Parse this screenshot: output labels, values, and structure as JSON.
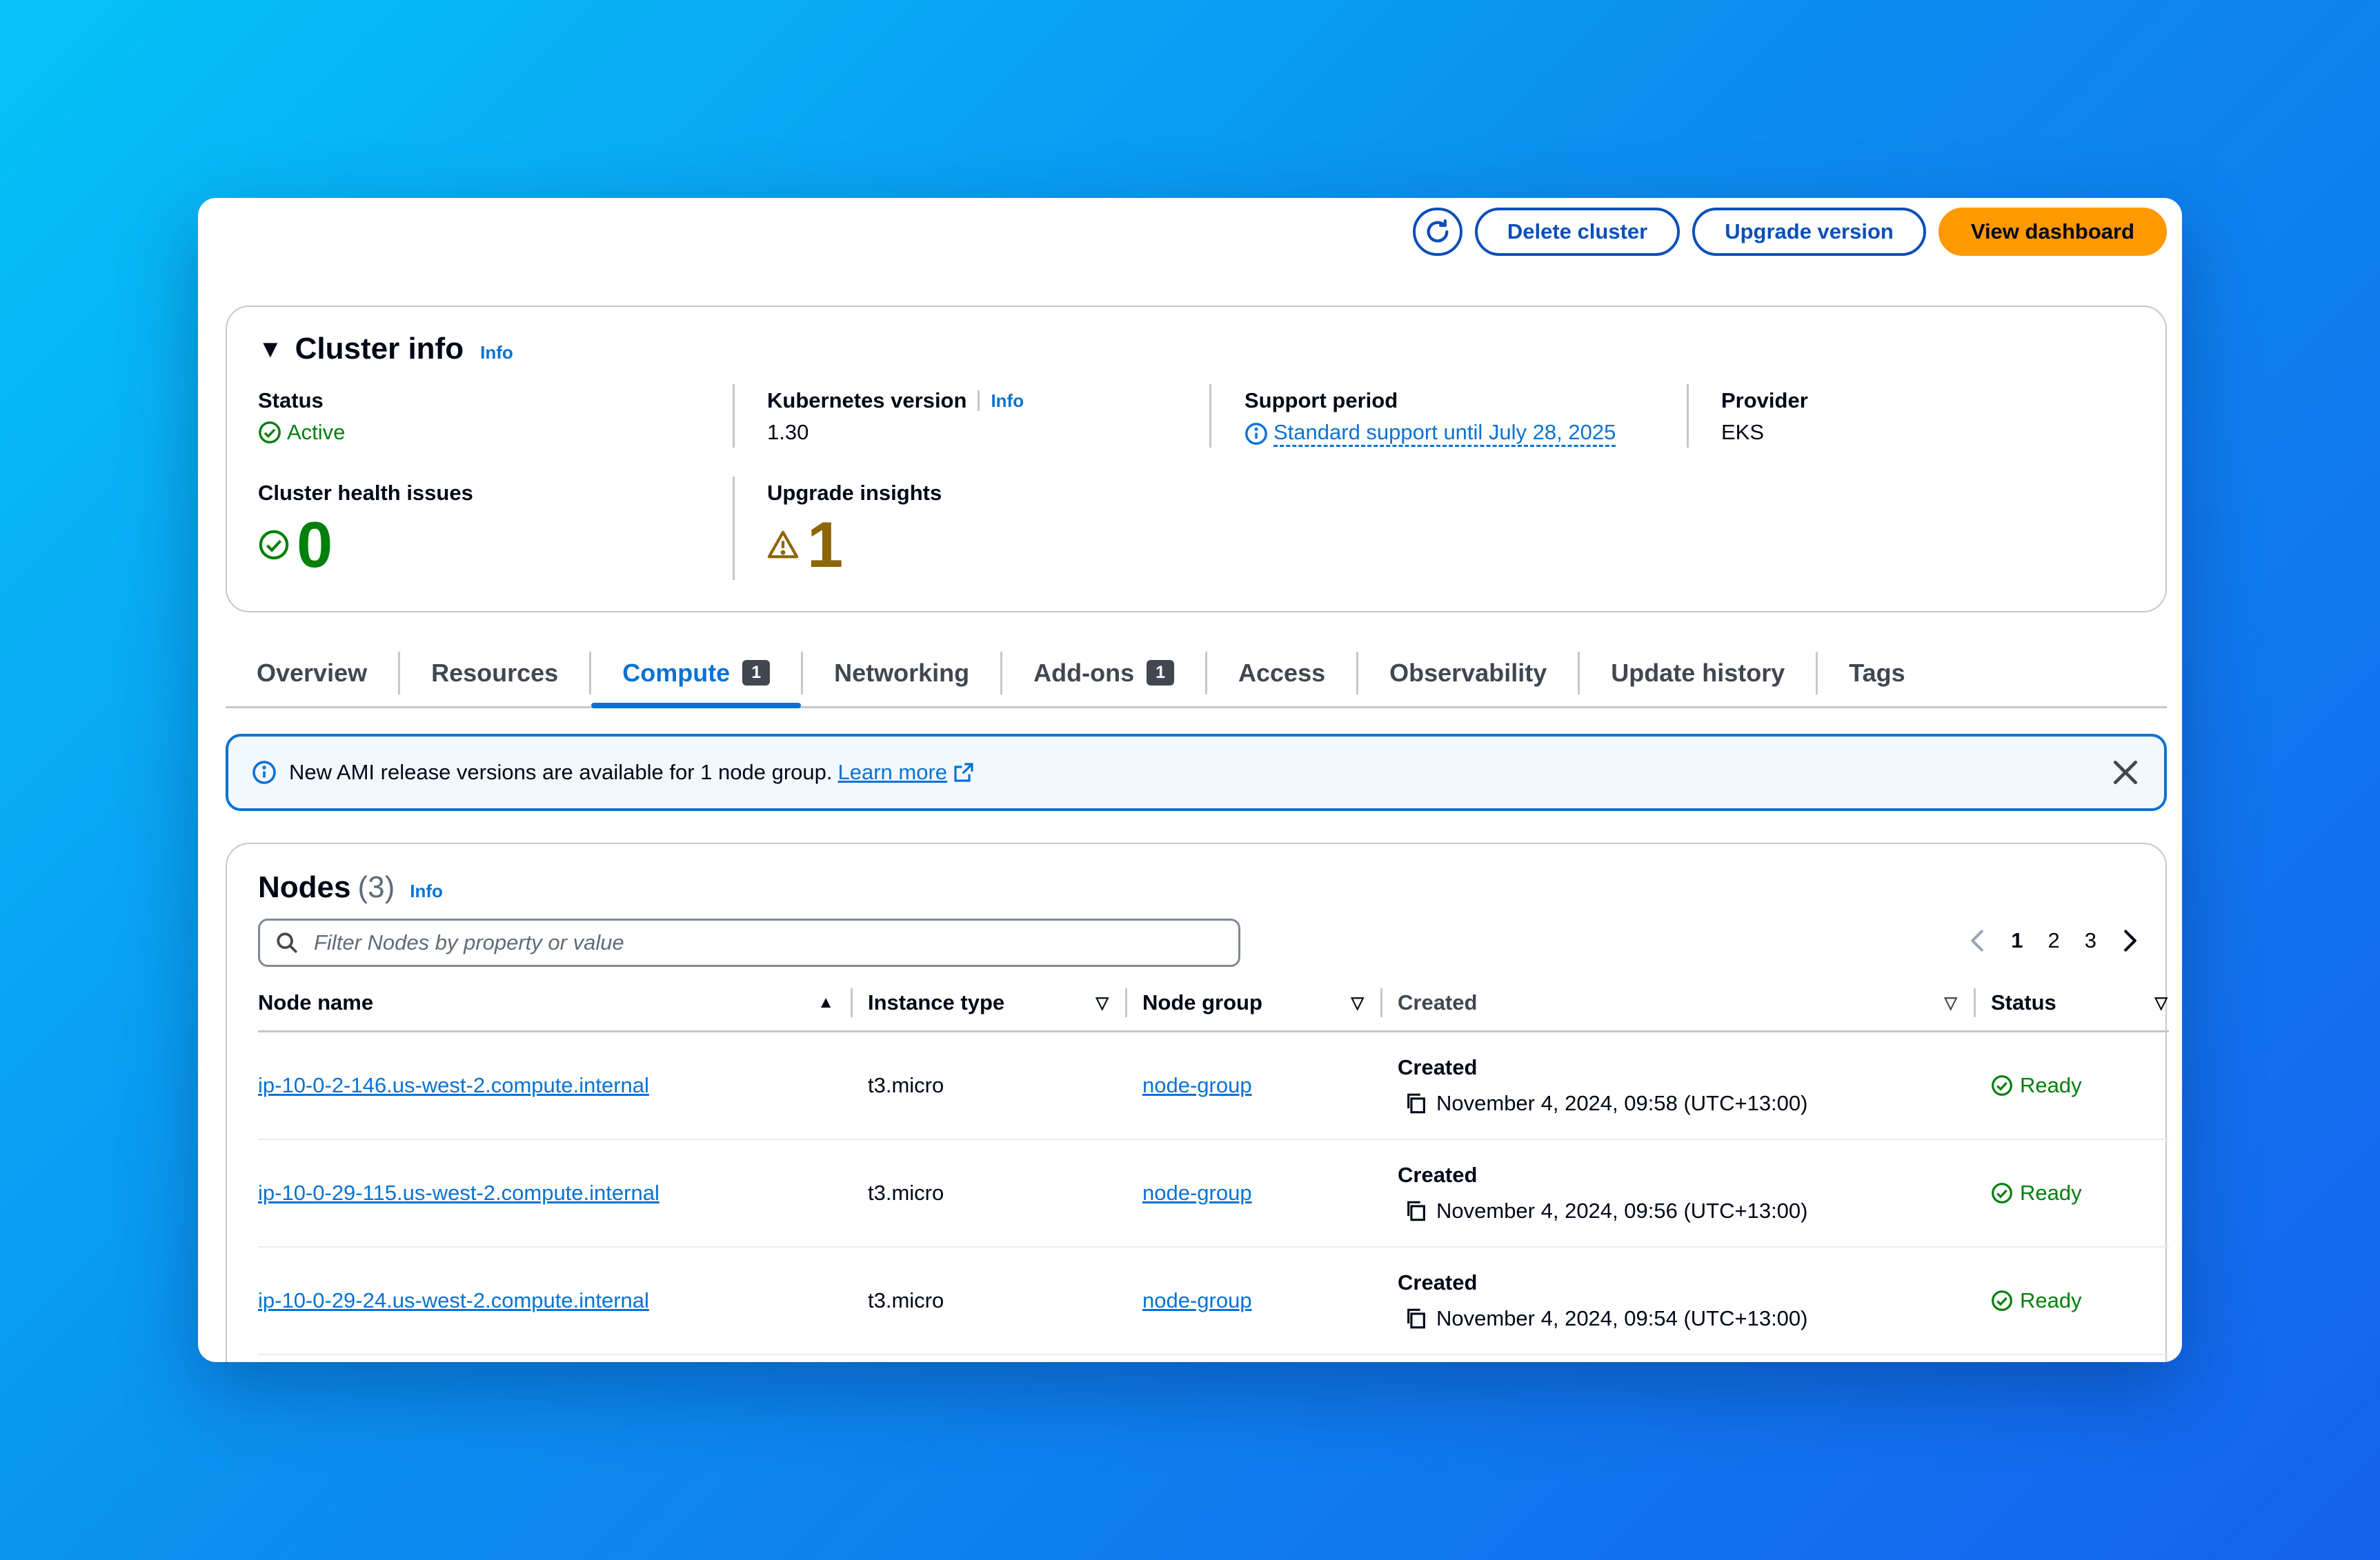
{
  "colors": {
    "accent": "#0972d3",
    "primary_button": "#ff9900",
    "success": "#037f0c",
    "warning": "#8d6605"
  },
  "toolbar": {
    "refresh_icon": "refresh-icon",
    "delete_label": "Delete cluster",
    "upgrade_label": "Upgrade version",
    "dashboard_label": "View dashboard"
  },
  "cluster_info": {
    "title": "Cluster info",
    "info_link": "Info",
    "status_label": "Status",
    "status_value": "Active",
    "k8s_label": "Kubernetes version",
    "k8s_info": "Info",
    "k8s_value": "1.30",
    "support_label": "Support period",
    "support_value": "Standard support until July 28, 2025",
    "provider_label": "Provider",
    "provider_value": "EKS",
    "health_label": "Cluster health issues",
    "health_value": "0",
    "insights_label": "Upgrade insights",
    "insights_value": "1"
  },
  "tabs": [
    {
      "label": "Overview"
    },
    {
      "label": "Resources"
    },
    {
      "label": "Compute",
      "badge": "1",
      "active": true
    },
    {
      "label": "Networking"
    },
    {
      "label": "Add-ons",
      "badge": "1"
    },
    {
      "label": "Access"
    },
    {
      "label": "Observability"
    },
    {
      "label": "Update history"
    },
    {
      "label": "Tags"
    }
  ],
  "alert": {
    "message": "New AMI release versions are available for 1 node group.",
    "link": "Learn more"
  },
  "nodes": {
    "title": "Nodes",
    "count": "(3)",
    "info_link": "Info",
    "search_placeholder": "Filter Nodes by property or value",
    "pages": [
      "1",
      "2",
      "3"
    ],
    "current_page": "1",
    "columns": [
      "Node name",
      "Instance type",
      "Node group",
      "Created",
      "Status"
    ],
    "rows": [
      {
        "name": "ip-10-0-2-146.us-west-2.compute.internal",
        "instance": "t3.micro",
        "group": "node-group",
        "created_label": "Created",
        "created": "November 4, 2024, 09:58 (UTC+13:00)",
        "status": "Ready"
      },
      {
        "name": "ip-10-0-29-115.us-west-2.compute.internal",
        "instance": "t3.micro",
        "group": "node-group",
        "created_label": "Created",
        "created": "November 4, 2024, 09:56 (UTC+13:00)",
        "status": "Ready"
      },
      {
        "name": "ip-10-0-29-24.us-west-2.compute.internal",
        "instance": "t3.micro",
        "group": "node-group",
        "created_label": "Created",
        "created": "November 4, 2024, 09:54 (UTC+13:00)",
        "status": "Ready"
      }
    ]
  }
}
